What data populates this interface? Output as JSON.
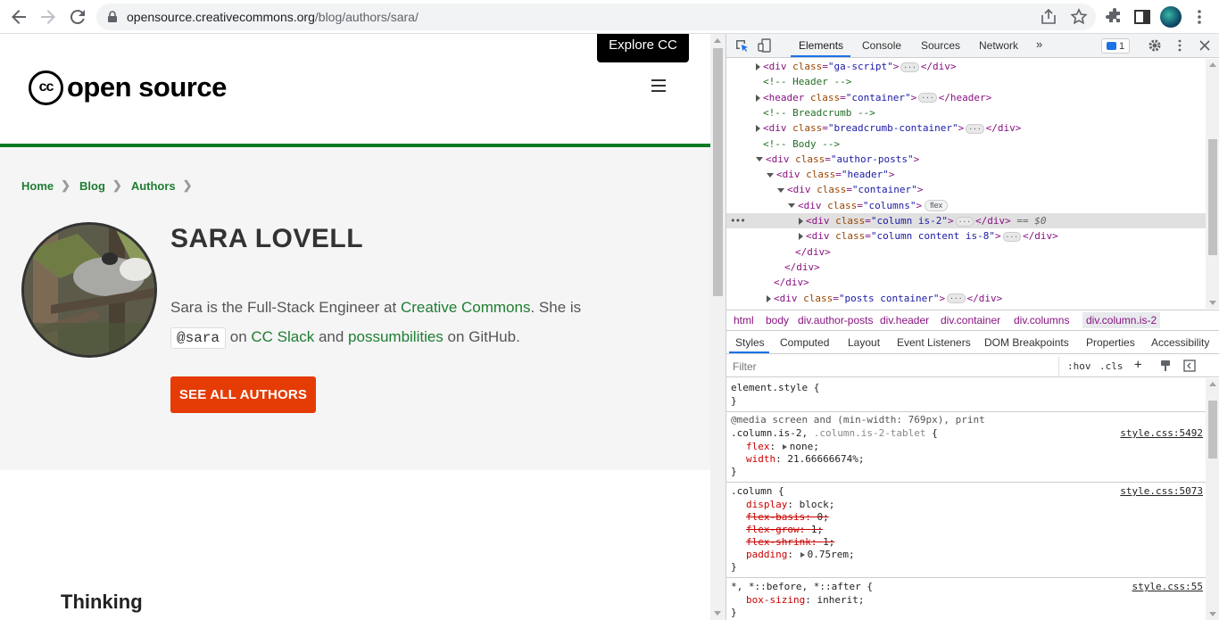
{
  "browser": {
    "url_host": "opensource.creativecommons.org",
    "url_path": "/blog/authors/sara/"
  },
  "site": {
    "explore_button": "Explore CC",
    "logo_cc": "cc",
    "logo_text": "open source",
    "breadcrumb": [
      "Home",
      "Blog",
      "Authors"
    ],
    "author_name": "SARA LOVELL",
    "bio": {
      "part1": "Sara is the Full-Stack Engineer at ",
      "link1": "Creative Commons",
      "part2": ". She is",
      "handle": "@sara",
      "part3": " on ",
      "link2": "CC Slack",
      "part4": " and ",
      "link3": "possumbilities",
      "part5": " on GitHub."
    },
    "see_all_button": "SEE ALL AUTHORS",
    "section_heading": "Thinking",
    "colors": {
      "accent_green": "#0b7a22",
      "button_orange": "#e53b05"
    }
  },
  "devtools": {
    "tabs": [
      "Elements",
      "Console",
      "Sources",
      "Network"
    ],
    "issues_count": "1",
    "dom": [
      {
        "indent": 0,
        "tri": "right",
        "html": "<div class=\"ga-script\">",
        "ell": true,
        "close": "</div>"
      },
      {
        "indent": 0,
        "comment": "<!-- Header -->"
      },
      {
        "indent": 0,
        "tri": "right",
        "html": "<header class=\"container\">",
        "ell": true,
        "close": "</header>"
      },
      {
        "indent": 0,
        "comment": "<!-- Breadcrumb -->"
      },
      {
        "indent": 0,
        "tri": "right",
        "html": "<div class=\"breadcrumb-container\">",
        "ell": true,
        "close": "</div>"
      },
      {
        "indent": 0,
        "comment": "<!-- Body -->"
      },
      {
        "indent": 0,
        "tri": "down",
        "html": "<div class=\"author-posts\">"
      },
      {
        "indent": 1,
        "tri": "down",
        "html": "<div class=\"header\">"
      },
      {
        "indent": 2,
        "tri": "down",
        "html": "<div class=\"container\">"
      },
      {
        "indent": 3,
        "tri": "down",
        "html": "<div class=\"columns\">",
        "badge": "flex"
      },
      {
        "indent": 4,
        "tri": "right",
        "html": "<div class=\"column is-2\">",
        "ell": true,
        "close": "</div>",
        "selected": true,
        "suffix": "== $0"
      },
      {
        "indent": 4,
        "tri": "right",
        "html": "<div class=\"column content is-8\">",
        "ell": true,
        "close": "</div>"
      },
      {
        "indent": 3,
        "html": "</div>"
      },
      {
        "indent": 2,
        "html": "</div>"
      },
      {
        "indent": 1,
        "html": "</div>"
      },
      {
        "indent": 1,
        "tri": "right",
        "html": "<div class=\"posts container\">",
        "ell": true,
        "close": "</div>"
      }
    ],
    "crumbs": [
      "html",
      "body",
      "div.author-posts",
      "div.header",
      "div.container",
      "div.columns",
      "div.column.is-2"
    ],
    "style_tabs": [
      "Styles",
      "Computed",
      "Layout",
      "Event Listeners",
      "DOM Breakpoints",
      "Properties",
      "Accessibility"
    ],
    "filter_placeholder": "Filter",
    "filter_tools": [
      ":hov",
      ".cls",
      "+"
    ],
    "rules": {
      "element_style": "element.style {",
      "media": "@media screen and (min-width: 769px), print",
      "selector1a": ".column.is-2, ",
      "selector1b": ".column.is-2-tablet",
      "src1": "style.css:5492",
      "flex_prop": "flex",
      "flex_val": "none;",
      "width_prop": "width",
      "width_val": "21.66666674%;",
      "selector2": ".column {",
      "src2": "style.css:5073",
      "display_prop": "display",
      "display_val": "block;",
      "fb_prop": "flex-basis",
      "fb_val": "0;",
      "fg_prop": "flex-grow",
      "fg_val": "1;",
      "fs_prop": "flex-shrink",
      "fs_val": "1;",
      "padding_prop": "padding",
      "padding_val": "0.75rem;",
      "selector3": "*, *::before, *::after {",
      "src3": "style.css:55",
      "bs_prop": "box-sizing",
      "bs_val": "inherit;"
    }
  }
}
